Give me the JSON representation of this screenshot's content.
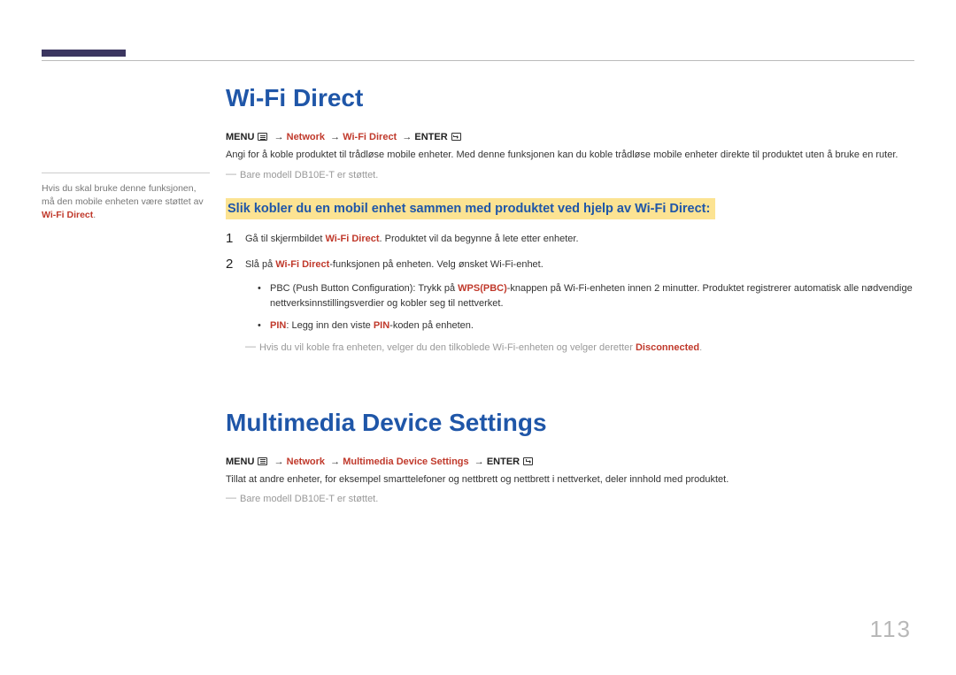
{
  "sidebar_note": {
    "pre": "Hvis du skal bruke denne funksjonen, må den mobile enheten være støttet av ",
    "hl": "Wi-Fi Direct",
    "post": "."
  },
  "section1": {
    "title": "Wi-Fi Direct",
    "path": {
      "menu": "MENU",
      "seg1": "Network",
      "seg2": "Wi-Fi Direct",
      "enter": "ENTER"
    },
    "desc": "Angi for å koble produktet til trådløse mobile enheter. Med denne funksjonen kan du koble trådløse mobile enheter direkte til produktet uten å bruke en ruter.",
    "note": "Bare modell DB10E-T er støttet.",
    "subhead": "Slik kobler du en mobil enhet sammen med produktet ved hjelp av Wi-Fi Direct:",
    "step1": {
      "num": "1",
      "pre": "Gå til skjermbildet ",
      "hl": "Wi-Fi Direct",
      "post": ". Produktet vil da begynne å lete etter enheter."
    },
    "step2": {
      "num": "2",
      "pre": "Slå på ",
      "hl": "Wi-Fi Direct",
      "post": "-funksjonen på enheten. Velg ønsket Wi-Fi-enhet."
    },
    "bullet1": {
      "pre": "PBC (Push Button Configuration): Trykk på ",
      "hl": "WPS(PBC)",
      "post": "-knappen på Wi-Fi-enheten innen 2 minutter. Produktet registrerer automatisk alle nødvendige nettverksinnstillingsverdier og kobler seg til nettverket."
    },
    "bullet2": {
      "hl1": "PIN",
      "mid": ": Legg inn den viste ",
      "hl2": "PIN",
      "post": "-koden på enheten."
    },
    "final_note": {
      "pre": "Hvis du vil koble fra enheten, velger du den tilkoblede Wi-Fi-enheten og velger deretter ",
      "hl": "Disconnected",
      "post": "."
    }
  },
  "section2": {
    "title": "Multimedia Device Settings",
    "path": {
      "menu": "MENU",
      "seg1": "Network",
      "seg2": "Multimedia Device Settings",
      "enter": "ENTER"
    },
    "desc": "Tillat at andre enheter, for eksempel smarttelefoner og nettbrett og nettbrett i nettverket, deler innhold med produktet.",
    "note": "Bare modell DB10E-T er støttet."
  },
  "page_number": "113"
}
